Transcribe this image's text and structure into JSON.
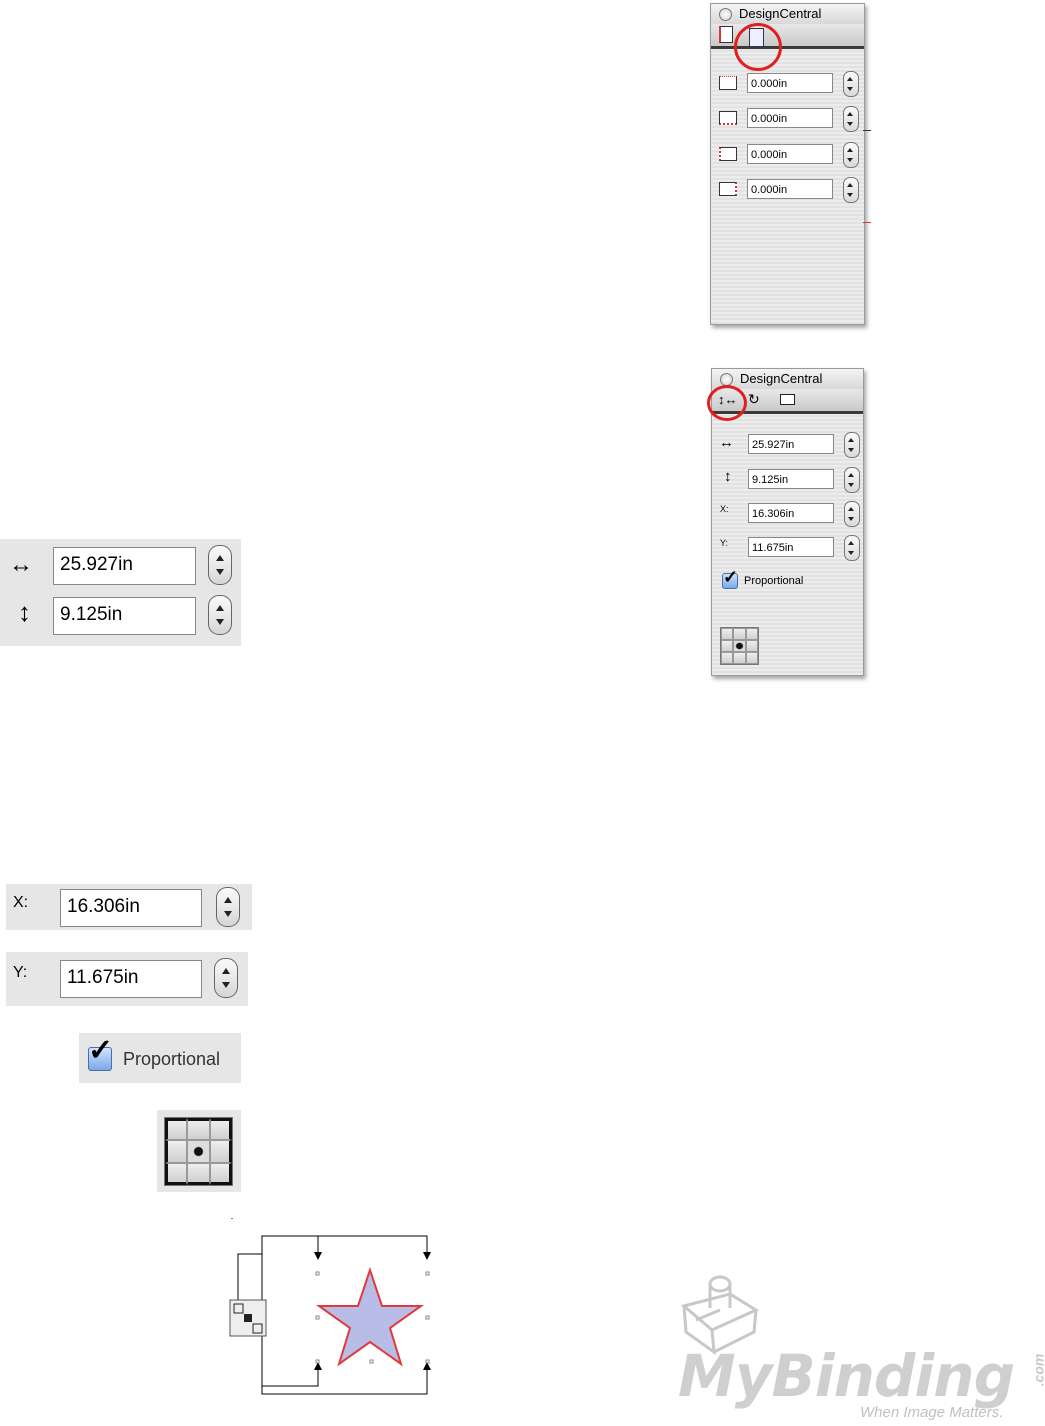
{
  "palette_margins": {
    "title": "DesignCentral",
    "fields": [
      "0.000in",
      "0.000in",
      "0.000in",
      "0.000in"
    ]
  },
  "palette_size": {
    "title": "DesignCentral",
    "width_value": "25.927in",
    "height_value": "9.125in",
    "x_label": "X:",
    "x_value": "16.306in",
    "y_label": "Y:",
    "y_value": "11.675in",
    "proportional_label": "Proportional",
    "proportional_checked": true
  },
  "detail": {
    "width_value": "25.927in",
    "height_value": "9.125in",
    "x_label": "X:",
    "x_value": "16.306in",
    "y_label": "Y:",
    "y_value": "11.675in",
    "proportional_label": "Proportional"
  },
  "icons": {
    "width": "horizontal-arrows-icon",
    "height": "vertical-arrows-icon",
    "reference_point": "reference-point-grid-icon",
    "star": "star-shape"
  },
  "colors": {
    "highlight_circle": "#e02020",
    "star_fill": "#b8bde8",
    "star_stroke": "#e03a3a",
    "logo_gray": "#c8c8c8"
  },
  "logo": {
    "name": "MyBinding",
    "suffix": ".com",
    "tagline": "When Image Matters."
  }
}
